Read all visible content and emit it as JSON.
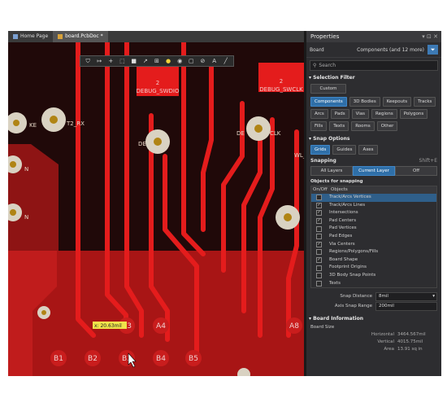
{
  "tabs": [
    {
      "label": "Home Page",
      "active": false
    },
    {
      "label": "board.PcbDoc *",
      "active": true
    }
  ],
  "toolbar_icons": [
    "filter-icon",
    "route-icon",
    "plus-icon",
    "select-rect-icon",
    "fill-icon",
    "arc-route-icon",
    "measure-icon",
    "pin-icon",
    "via-icon",
    "polygon-icon",
    "keepout-icon",
    "text-icon",
    "line-icon"
  ],
  "pcb": {
    "labels": {
      "debug_swdio": "DEBUG_SWDIO",
      "debug_swclk": "DEBUG_SWCLK",
      "pad2_a": "2",
      "pad2_b": "2",
      "txt_rx": "T2_RX",
      "txt_ke": "KE",
      "txt_de": "DE",
      "txt_wl": "WL_",
      "txt_clk": "CLK",
      "txt_n": "N",
      "txt_n2": "N"
    },
    "cursor_readout": "x: 20.63mil",
    "pin_labels": [
      "B1",
      "B2",
      "B3",
      "B4",
      "B5",
      "A3",
      "A4",
      "A8"
    ],
    "colors": {
      "board_dark": "#2a0d0d",
      "board_red": "#b01717",
      "track": "#e31b1b",
      "pad": "#d9d2c2",
      "pad_hole": "#b08414"
    }
  },
  "panel": {
    "title": "Properties",
    "board_label": "Board",
    "components_label": "Components (and 12 more)",
    "search_placeholder": "Search",
    "selection_filter": {
      "title": "Selection Filter",
      "custom": "Custom",
      "chips": [
        {
          "label": "Components",
          "on": true
        },
        {
          "label": "3D Bodies",
          "on": false
        },
        {
          "label": "Keepouts",
          "on": false
        },
        {
          "label": "Tracks",
          "on": false
        },
        {
          "label": "Arcs",
          "on": false
        },
        {
          "label": "Pads",
          "on": false
        },
        {
          "label": "Vias",
          "on": false
        },
        {
          "label": "Regions",
          "on": false
        },
        {
          "label": "Polygons",
          "on": false
        },
        {
          "label": "Fills",
          "on": false
        },
        {
          "label": "Texts",
          "on": false
        },
        {
          "label": "Rooms",
          "on": false
        },
        {
          "label": "Other",
          "on": false
        }
      ]
    },
    "snap_options": {
      "title": "Snap Options",
      "tabs": [
        {
          "label": "Grids",
          "on": true
        },
        {
          "label": "Guides",
          "on": false
        },
        {
          "label": "Axes",
          "on": false
        }
      ],
      "snapping_label": "Snapping",
      "shortcut": "Shift+E",
      "layers": [
        {
          "label": "All Layers",
          "on": false
        },
        {
          "label": "Current Layer",
          "on": true
        },
        {
          "label": "Off",
          "on": false
        }
      ],
      "objects_label": "Objects for snapping",
      "col_onoff": "On/Off",
      "col_objects": "Objects",
      "objects": [
        {
          "label": "Track/Arcs Vertices",
          "checked": false,
          "selected": true
        },
        {
          "label": "Track/Arcs Lines",
          "checked": true,
          "selected": false
        },
        {
          "label": "Intersections",
          "checked": true,
          "selected": false
        },
        {
          "label": "Pad Centers",
          "checked": true,
          "selected": false
        },
        {
          "label": "Pad Vertices",
          "checked": false,
          "selected": false
        },
        {
          "label": "Pad Edges",
          "checked": false,
          "selected": false
        },
        {
          "label": "Via Centers",
          "checked": true,
          "selected": false
        },
        {
          "label": "Regions/Polygons/Fills",
          "checked": false,
          "selected": false
        },
        {
          "label": "Board Shape",
          "checked": true,
          "selected": false
        },
        {
          "label": "Footprint Origins",
          "checked": false,
          "selected": false
        },
        {
          "label": "3D Body Snap Points",
          "checked": false,
          "selected": false
        },
        {
          "label": "Texts",
          "checked": false,
          "selected": false
        }
      ],
      "snap_distance_label": "Snap Distance",
      "snap_distance_value": "8mil",
      "axis_snap_label": "Axis Snap Range",
      "axis_snap_value": "200mil"
    },
    "board_info": {
      "title": "Board Information",
      "size_label": "Board Size",
      "horizontal_label": "Horizontal",
      "horizontal_value": "3464.567mil",
      "vertical_label": "Vertical",
      "vertical_value": "4015.75mil",
      "area_label": "Area",
      "area_value": "13.91 sq in"
    }
  }
}
